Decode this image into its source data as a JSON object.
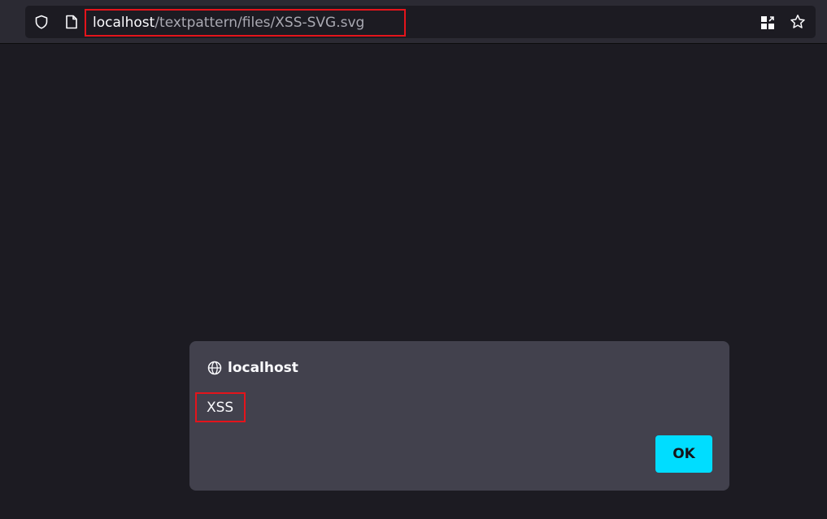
{
  "browser": {
    "url": {
      "host": "localhost",
      "path": "/textpattern/files/XSS-SVG.svg"
    },
    "icons": {
      "shield": "tracking-protection-shield-icon",
      "page": "page-info-icon",
      "qr": "qr-code-icon",
      "star": "bookmark-star-icon"
    }
  },
  "dialog": {
    "origin": "localhost",
    "message": "XSS",
    "ok_label": "OK"
  },
  "colors": {
    "page_background": "#1c1b22",
    "toolbar": "#2b2a33",
    "dialog_background": "#42414d",
    "accent_button": "#00ddff",
    "highlight_box": "#e4141b"
  }
}
